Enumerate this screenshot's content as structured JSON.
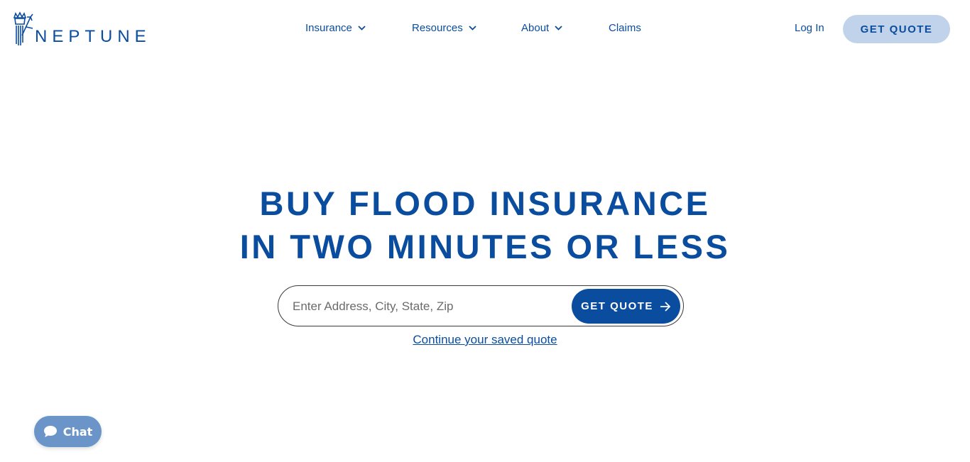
{
  "brand": {
    "name": "NEPTUNE",
    "color": "#0a4c9e"
  },
  "nav": {
    "items": [
      {
        "label": "Insurance",
        "has_dropdown": true
      },
      {
        "label": "Resources",
        "has_dropdown": true
      },
      {
        "label": "About",
        "has_dropdown": true
      },
      {
        "label": "Claims",
        "has_dropdown": false
      }
    ]
  },
  "header": {
    "login_label": "Log In",
    "quote_label": "GET QUOTE"
  },
  "hero": {
    "title_line1": "BUY FLOOD INSURANCE",
    "title_line2": "IN TWO MINUTES OR LESS"
  },
  "search": {
    "placeholder": "Enter Address, City, State, Zip",
    "value": "",
    "button_label": "GET QUOTE"
  },
  "saved_quote": {
    "label": "Continue your saved quote"
  },
  "chat": {
    "label": "Chat"
  },
  "icons": {
    "logo": "neptune-trident-logo-icon",
    "chevron": "chevron-down-icon",
    "arrow": "arrow-right-icon",
    "chat": "chat-bubble-icon"
  },
  "colors": {
    "primary": "#0a4c9e",
    "light_button": "#c1d3ea",
    "chat_button": "#6b95c9"
  }
}
